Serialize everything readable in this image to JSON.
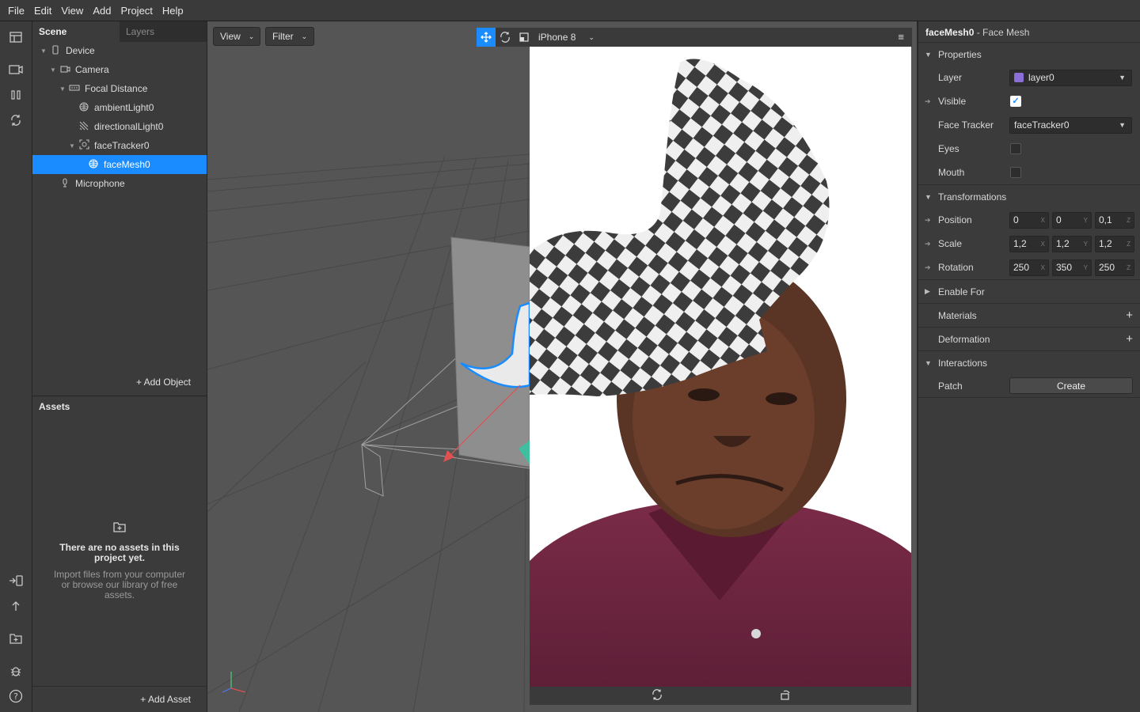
{
  "menubar": {
    "items": [
      "File",
      "Edit",
      "View",
      "Add",
      "Project",
      "Help"
    ]
  },
  "scene": {
    "tabs": {
      "scene": "Scene",
      "layers": "Layers"
    },
    "tree": [
      {
        "label": "Device",
        "icon": "device-icon"
      },
      {
        "label": "Camera",
        "icon": "camera-icon"
      },
      {
        "label": "Focal Distance",
        "icon": "focal-distance-icon"
      },
      {
        "label": "ambientLight0",
        "icon": "ambient-light-icon"
      },
      {
        "label": "directionalLight0",
        "icon": "directional-light-icon"
      },
      {
        "label": "faceTracker0",
        "icon": "face-tracker-icon"
      },
      {
        "label": "faceMesh0",
        "icon": "face-mesh-icon",
        "selected": true
      },
      {
        "label": "Microphone",
        "icon": "microphone-icon"
      }
    ],
    "add_object": "+ Add Object"
  },
  "assets": {
    "title": "Assets",
    "empty_title": "There are no assets in this project yet.",
    "empty_sub": "Import files from your computer or browse our library of free assets.",
    "add_asset": "+ Add Asset"
  },
  "viewport": {
    "view_label": "View",
    "filter_label": "Filter",
    "device": "iPhone 8"
  },
  "properties": {
    "title_name": "faceMesh0",
    "title_type": " - Face Mesh",
    "sections": {
      "properties": "Properties",
      "transformations": "Transformations",
      "enable_for": "Enable For",
      "materials": "Materials",
      "deformation": "Deformation",
      "interactions": "Interactions"
    },
    "layer": {
      "label": "Layer",
      "value": "layer0",
      "color": "#8c6fd6"
    },
    "visible": {
      "label": "Visible",
      "checked": true
    },
    "face_tracker": {
      "label": "Face Tracker",
      "value": "faceTracker0"
    },
    "eyes": {
      "label": "Eyes",
      "checked": false
    },
    "mouth": {
      "label": "Mouth",
      "checked": false
    },
    "position": {
      "label": "Position",
      "x": "0",
      "y": "0",
      "z": "0,1"
    },
    "scale": {
      "label": "Scale",
      "x": "1,2",
      "y": "1,2",
      "z": "1,2"
    },
    "rotation": {
      "label": "Rotation",
      "x": "250",
      "y": "350",
      "z": "250"
    },
    "patch": {
      "label": "Patch",
      "button": "Create"
    },
    "axes": {
      "x": "X",
      "y": "Y",
      "z": "Z"
    }
  },
  "colors": {
    "accent": "#1a8cff",
    "panel": "#3b3b3b",
    "viewport": "#555555"
  }
}
